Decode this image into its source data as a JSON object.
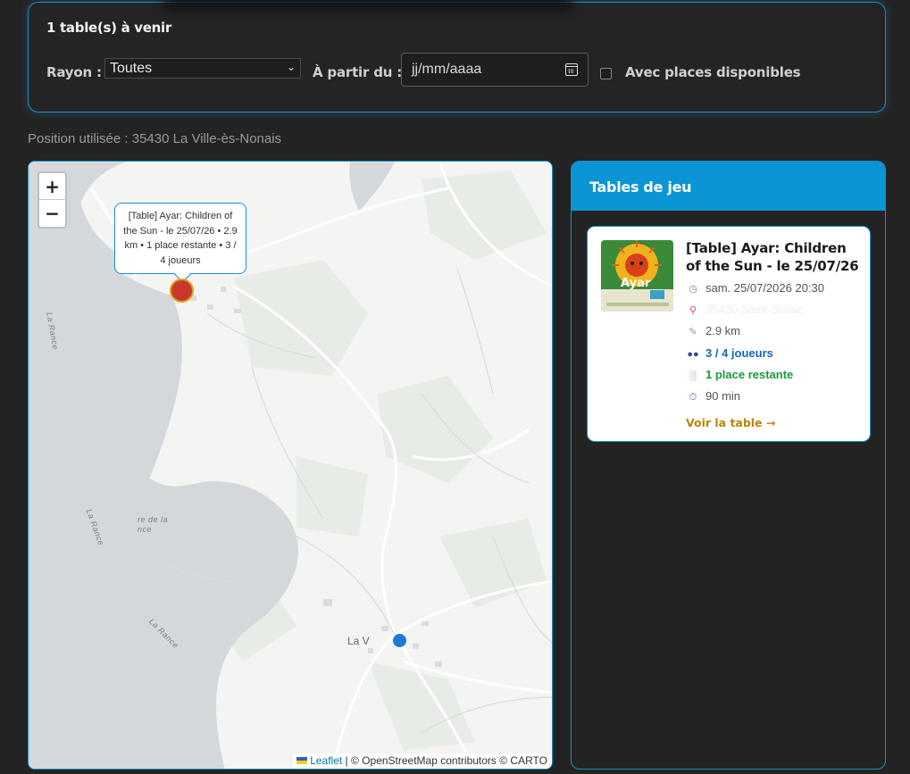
{
  "filters": {
    "upcoming_count": "1 table(s) à venir",
    "rayon_label": "Rayon :",
    "rayon_value": "Toutes",
    "from_label": "À partir du :",
    "date_placeholder": "jj/mm/aaaa",
    "available_label": "Avec places disponibles",
    "available_checked": false
  },
  "position_text": "Position utilisée : 35430 La Ville-ès-Nonais",
  "map": {
    "zoom_in": "+",
    "zoom_out": "−",
    "popup_text": "[Table] Ayar: Children of the Sun - le 25/07/26 • 2.9 km • 1 place restante • 3 / 4 joueurs",
    "water_labels": [
      "La Rance",
      "La Rance",
      "La Rance",
      "re de la nce"
    ],
    "town_label": "La V",
    "attribution_link": "Leaflet",
    "attribution_text": " | © OpenStreetMap contributors © CARTO",
    "colors": {
      "game_marker": "#c8392b",
      "user_marker": "#1f7bd6"
    }
  },
  "panel": {
    "title": "Tables de jeu",
    "tables": [
      {
        "title": "[Table] Ayar: Children of the Sun - le 25/07/26",
        "datetime": "sam. 25/07/2026 20:30",
        "location": "35430 Saint-Suliac",
        "distance": "2.9 km",
        "players": "3 / 4 joueurs",
        "places": "1 place restante",
        "duration": "90 min",
        "link": "Voir la table →",
        "thumb_text": "Ayar"
      }
    ]
  },
  "icons": {
    "datetime": "clock-icon",
    "location": "pin-icon",
    "distance": "ruler-icon",
    "players": "people-icon",
    "places": "chair-icon",
    "duration": "stopwatch-icon"
  }
}
